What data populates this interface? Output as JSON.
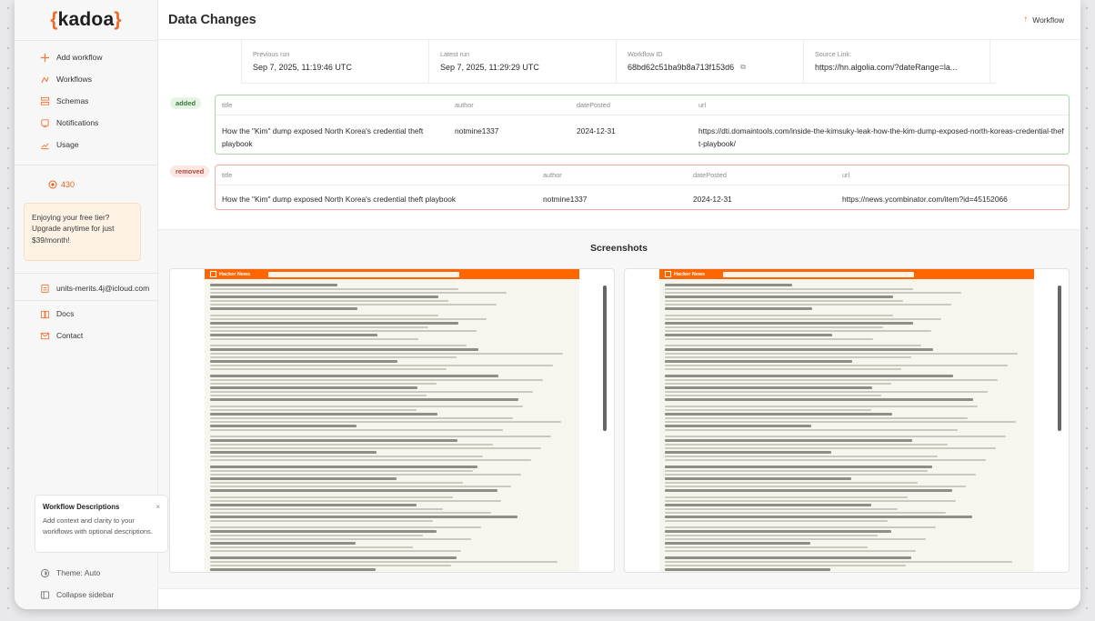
{
  "logo": {
    "open": "{",
    "word": "kadoa",
    "close": "}"
  },
  "sidebar": {
    "items": [
      {
        "label": "Add workflow",
        "icon": "plus-icon"
      },
      {
        "label": "Workflows",
        "icon": "workflows-icon"
      },
      {
        "label": "Schemas",
        "icon": "schema-icon"
      },
      {
        "label": "Notifications",
        "icon": "bell-icon"
      },
      {
        "label": "Usage",
        "icon": "chart-icon"
      }
    ],
    "credits": "430",
    "promo": "Enjoying your free tier? Upgrade anytime for just $39/month!",
    "account": "units-merits.4j@icloud.com",
    "links": [
      {
        "label": "Docs",
        "icon": "book-icon"
      },
      {
        "label": "Contact",
        "icon": "mail-icon"
      }
    ],
    "desc_card": {
      "title": "Workflow Descriptions",
      "close": "×",
      "text": "Add context and clarity to your workflows with optional descriptions."
    },
    "theme": "Theme: Auto",
    "collapse": "Collapse sidebar"
  },
  "header": {
    "title": "Data Changes",
    "workflow_link": "Workflow",
    "workflow_arrow": "↑"
  },
  "meta": [
    {
      "label": "Previous run",
      "value": "Sep 7, 2025, 11:19:46 UTC"
    },
    {
      "label": "Latest run",
      "value": "Sep 7, 2025, 11:29:29 UTC"
    },
    {
      "label": "Workflow ID",
      "value": "68bd62c51ba9b8a713f153d6"
    },
    {
      "label": "Source Link:",
      "value": "https://hn.algolia.com/?dateRange=la..."
    }
  ],
  "added": {
    "badge": "added",
    "columns": [
      "title",
      "author",
      "datePosted",
      "url"
    ],
    "row": {
      "title": "How the \"Kim\" dump exposed North Korea's credential theft playbook",
      "author": "notmine1337",
      "datePosted": "2024-12-31",
      "url": "https://dti.domaintools.com/inside-the-kimsuky-leak-how-the-kim-dump-exposed-north-koreas-credential-theft-playbook/"
    }
  },
  "removed": {
    "badge": "removed",
    "columns": [
      "title",
      "author",
      "datePosted",
      "url"
    ],
    "row": {
      "title": "How the \"Kim\" dump exposed North Korea's credential theft playbook",
      "author": "notmine1337",
      "datePosted": "2024-12-31",
      "url": "https://news.ycombinator.com/item?id=45152066"
    }
  },
  "screenshots": {
    "title": "Screenshots",
    "site": "Hacker News"
  }
}
